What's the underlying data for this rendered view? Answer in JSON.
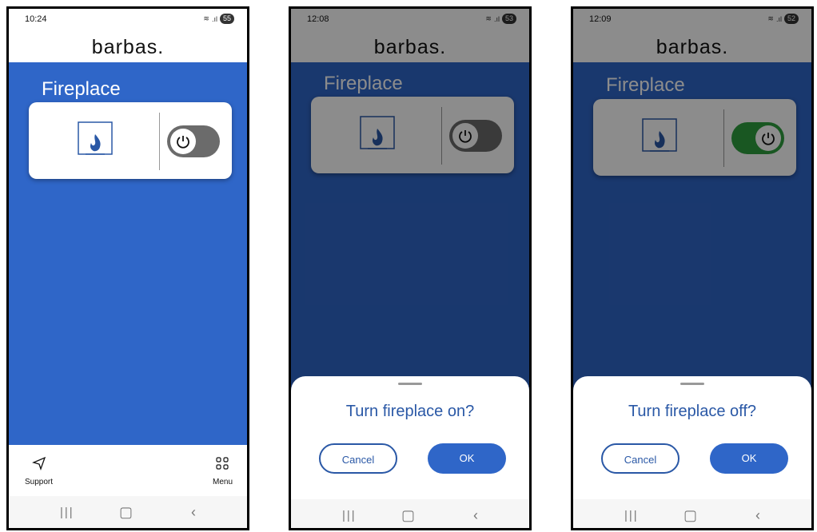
{
  "app": {
    "logo": "barbas."
  },
  "screens": [
    {
      "status": {
        "time": "10:24",
        "battery": "55"
      },
      "title": "Fireplace",
      "toggle_state": "off",
      "nav": {
        "support": "Support",
        "menu": "Menu"
      }
    },
    {
      "status": {
        "time": "12:08",
        "battery": "53"
      },
      "title": "Fireplace",
      "toggle_state": "off",
      "dialog": {
        "question": "Turn fireplace on?",
        "cancel": "Cancel",
        "ok": "OK"
      }
    },
    {
      "status": {
        "time": "12:09",
        "battery": "52"
      },
      "title": "Fireplace",
      "toggle_state": "on",
      "dialog": {
        "question": "Turn fireplace off?",
        "cancel": "Cancel",
        "ok": "OK"
      }
    }
  ],
  "colors": {
    "brand_blue": "#2f66c8",
    "toggle_on": "#2e9e3e",
    "toggle_off": "#6b6b6b",
    "dialog_text": "#2a58a6"
  },
  "icons": [
    "flame-icon",
    "power-icon",
    "send-icon",
    "grid-menu-icon",
    "recent-apps-icon",
    "home-icon",
    "back-icon",
    "wifi-icon",
    "signal-icon"
  ]
}
